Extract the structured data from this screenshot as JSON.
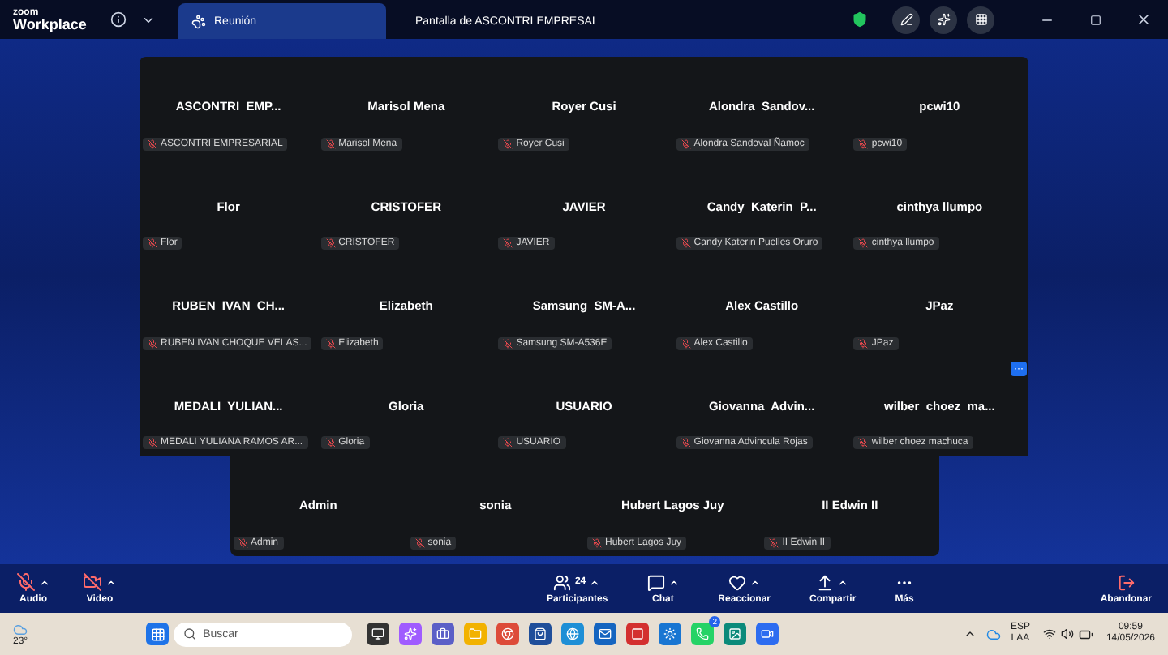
{
  "app": {
    "logo_small": "zoom",
    "logo_large": "Workplace"
  },
  "tabs": [
    {
      "label": "Reunión",
      "selected": true
    },
    {
      "label": "Pantalla de ASCONTRI EMPRESAI",
      "selected": false
    }
  ],
  "participants": [
    {
      "title": "ASCONTRI  EMP...",
      "tag": "ASCONTRI EMPRESARIAL",
      "muted": true
    },
    {
      "title": "Marisol Mena",
      "tag": "Marisol Mena",
      "muted": true
    },
    {
      "title": "Royer Cusi",
      "tag": "Royer Cusi",
      "muted": true
    },
    {
      "title": "Alondra  Sandov...",
      "tag": "Alondra Sandoval Ñamoc",
      "muted": true
    },
    {
      "title": "pcwi10",
      "tag": "pcwi10",
      "muted": true
    },
    {
      "title": "Flor",
      "tag": "Flor",
      "muted": true
    },
    {
      "title": "CRISTOFER",
      "tag": "CRISTOFER",
      "muted": true
    },
    {
      "title": "JAVIER",
      "tag": "JAVIER",
      "muted": true
    },
    {
      "title": "Candy  Katerin  P...",
      "tag": "Candy Katerin Puelles Oruro",
      "muted": true
    },
    {
      "title": "cinthya llumpo",
      "tag": "cinthya llumpo",
      "muted": true
    },
    {
      "title": "RUBEN  IVAN  CH...",
      "tag": "RUBEN IVAN CHOQUE VELAS...",
      "muted": true
    },
    {
      "title": "Elizabeth",
      "tag": "Elizabeth",
      "muted": true
    },
    {
      "title": "Samsung  SM-A...",
      "tag": "Samsung SM-A536E",
      "muted": true
    },
    {
      "title": "Alex Castillo",
      "tag": "Alex Castillo",
      "muted": true
    },
    {
      "title": "JPaz",
      "tag": "JPaz",
      "muted": true
    },
    {
      "title": "MEDALI  YULIAN...",
      "tag": "MEDALI YULIANA RAMOS AR...",
      "muted": true
    },
    {
      "title": "Gloria",
      "tag": "Gloria",
      "muted": true
    },
    {
      "title": "USUARIO",
      "tag": "USUARIO",
      "muted": true
    },
    {
      "title": "Giovanna  Advin...",
      "tag": "Giovanna Advincula Rojas",
      "muted": true
    },
    {
      "title": "wilber  choez  ma...",
      "tag": "wilber choez machuca",
      "muted": true
    }
  ],
  "participants_last_row": [
    {
      "title": "Admin",
      "tag": "Admin",
      "muted": true
    },
    {
      "title": "sonia",
      "tag": "sonia",
      "muted": true
    },
    {
      "title": "Hubert Lagos Juy",
      "tag": "Hubert Lagos Juy",
      "muted": true
    },
    {
      "title": "II Edwin II",
      "tag": "II Edwin II",
      "muted": true
    }
  ],
  "gallery_more": "···",
  "toolbar": [
    {
      "kind": "audio",
      "label": "Audio",
      "muted": true,
      "caret": true
    },
    {
      "kind": "video",
      "label": "Video",
      "muted": true,
      "caret": true
    },
    {
      "kind": "participants",
      "label": "Participantes",
      "count": "24",
      "caret": true
    },
    {
      "kind": "chat",
      "label": "Chat",
      "caret": true
    },
    {
      "kind": "react",
      "label": "Reaccionar",
      "caret": true
    },
    {
      "kind": "share",
      "label": "Compartir",
      "caret": true
    },
    {
      "kind": "more",
      "label": "Más",
      "caret": false
    }
  ],
  "leave": {
    "label": "Abandonar"
  },
  "taskbar": {
    "weather": "23°",
    "search_placeholder": "Buscar",
    "whatsapp_badge": "2",
    "lang": "ESP",
    "layout": "LAA",
    "time": "09:59",
    "date": "14/05/2026"
  }
}
